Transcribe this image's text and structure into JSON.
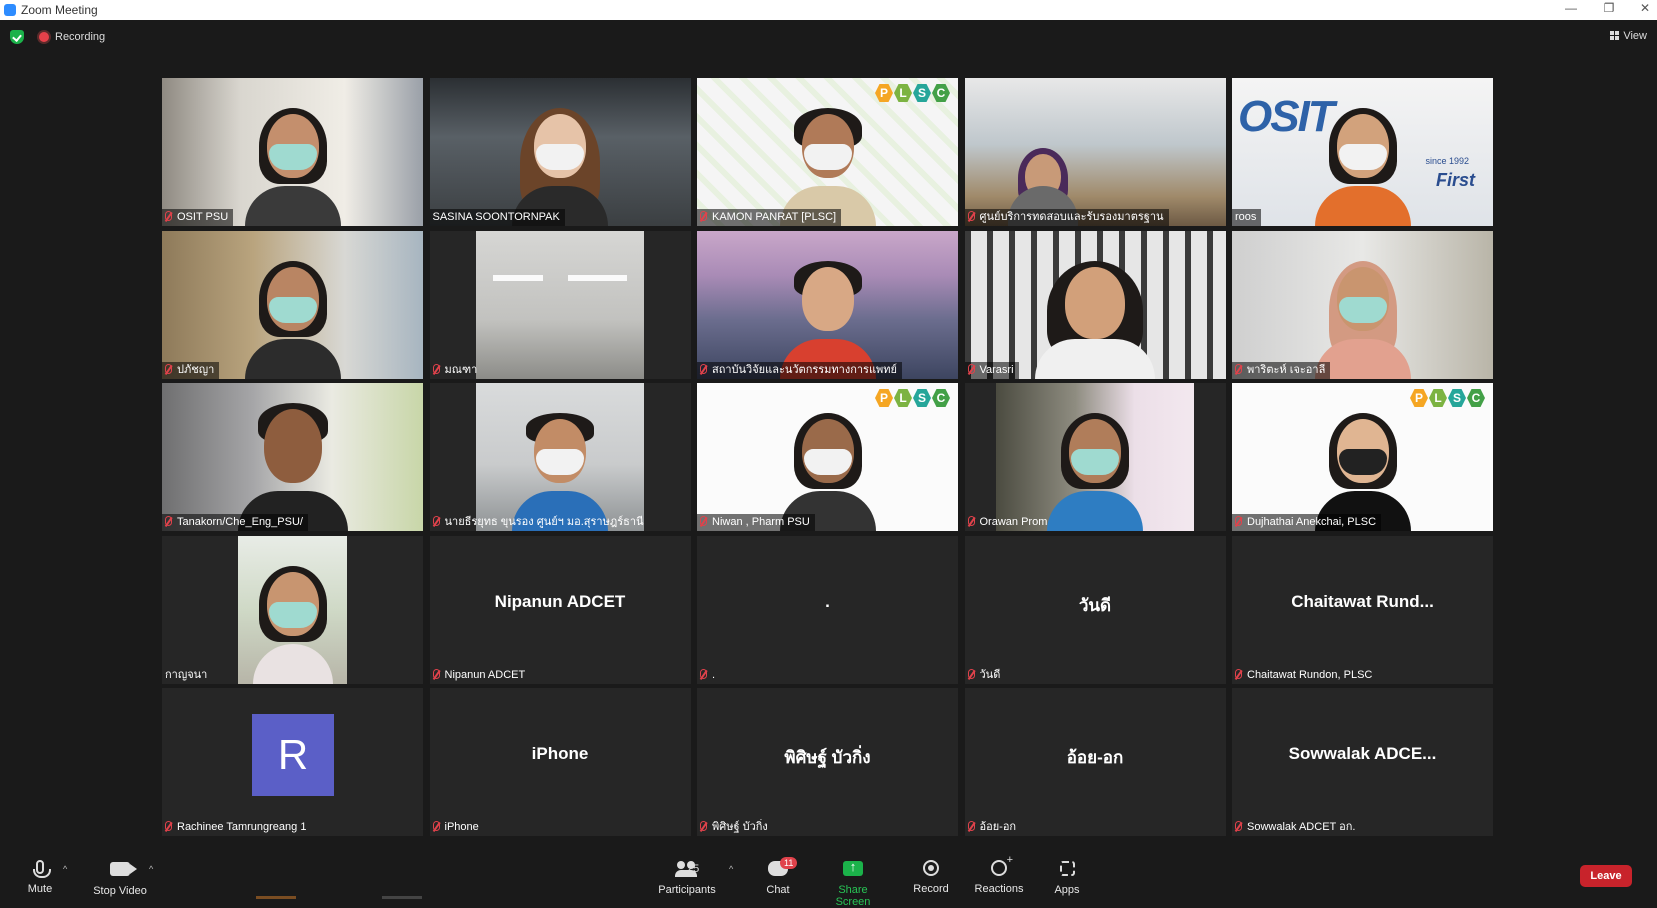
{
  "window": {
    "title": "Zoom Meeting",
    "controls": [
      "—",
      "❐",
      "✕"
    ]
  },
  "meeting": {
    "recording_label": "Recording",
    "view_label": "View"
  },
  "tiles": [
    {
      "name": "OSIT PSU",
      "type": "video",
      "muted": true,
      "active": false
    },
    {
      "name": "SASINA SOONTORNPAK",
      "type": "video",
      "muted": false,
      "active": true
    },
    {
      "name": "KAMON PANRAT [PLSC]",
      "type": "video",
      "muted": true,
      "active": false
    },
    {
      "name": "ศูนย์บริการทดสอบและรับรองมาตรฐาน",
      "type": "video",
      "muted": true,
      "active": false
    },
    {
      "name": "roos",
      "type": "video",
      "muted": false,
      "active": false
    },
    {
      "name": "ปภัชญา",
      "type": "video",
      "muted": true,
      "active": false
    },
    {
      "name": "มณฑา",
      "type": "video",
      "muted": true,
      "active": false
    },
    {
      "name": "สถาบันวิจัยและนวัตกรรมทางการแพทย์",
      "type": "video",
      "muted": true,
      "active": false
    },
    {
      "name": "Varasri",
      "type": "video",
      "muted": true,
      "active": false
    },
    {
      "name": "พาริตะห์ เจะอาลี",
      "type": "video",
      "muted": true,
      "active": false
    },
    {
      "name": "Tanakorn/Che_Eng_PSU/",
      "type": "video",
      "muted": true,
      "active": false
    },
    {
      "name": "นายธีรยุทธ ขุนรอง ศูนย์ฯ มอ.สุราษฎร์ธานี",
      "type": "video",
      "muted": true,
      "active": false
    },
    {
      "name": "Niwan , Pharm PSU",
      "type": "video",
      "muted": true,
      "active": false
    },
    {
      "name": "Orawan Prom",
      "type": "video",
      "muted": true,
      "active": false
    },
    {
      "name": "Dujhathai Anekchai, PLSC",
      "type": "video",
      "muted": true,
      "active": false
    },
    {
      "name": "กาญจนา",
      "type": "video",
      "muted": false,
      "active": false
    },
    {
      "name": "Nipanun ADCET",
      "display": "Nipanun ADCET",
      "type": "name",
      "muted": true,
      "active": false
    },
    {
      "name": ".",
      "display": ".",
      "type": "name",
      "muted": true,
      "active": false
    },
    {
      "name": "วันดี",
      "display": "วันดี",
      "type": "name",
      "muted": true,
      "active": false
    },
    {
      "name": "Chaitawat Rundon, PLSC",
      "display": "Chaitawat Rund...",
      "type": "name",
      "muted": true,
      "active": false
    },
    {
      "name": "Rachinee Tamrungreang 1",
      "display": "R",
      "type": "avatar",
      "muted": true,
      "active": false
    },
    {
      "name": "iPhone",
      "display": "iPhone",
      "type": "name",
      "muted": true,
      "active": false
    },
    {
      "name": "พิศิษฐ์ บัวกิ่ง",
      "display": "พิศิษฐ์ บัวกิ่ง",
      "type": "name",
      "muted": true,
      "active": false
    },
    {
      "name": "อ้อย-อก",
      "display": "อ้อย-อก",
      "type": "name",
      "muted": true,
      "active": false
    },
    {
      "name": "Sowwalak ADCET อก.",
      "display": "Sowwalak ADCE...",
      "type": "name",
      "muted": true,
      "active": false
    }
  ],
  "toolbar": {
    "mute_label": "Mute",
    "stop_video_label": "Stop Video",
    "participants_label": "Participants",
    "participants_count": "25",
    "chat_label": "Chat",
    "chat_badge": "11",
    "share_label": "Share Screen",
    "record_label": "Record",
    "reactions_label": "Reactions",
    "apps_label": "Apps",
    "leave_label": "Leave"
  },
  "colors": {
    "accent_active": "#e0f03c",
    "share_green": "#1bb24a",
    "leave_red": "#c8232b",
    "avatar": "#5b5fc7"
  }
}
